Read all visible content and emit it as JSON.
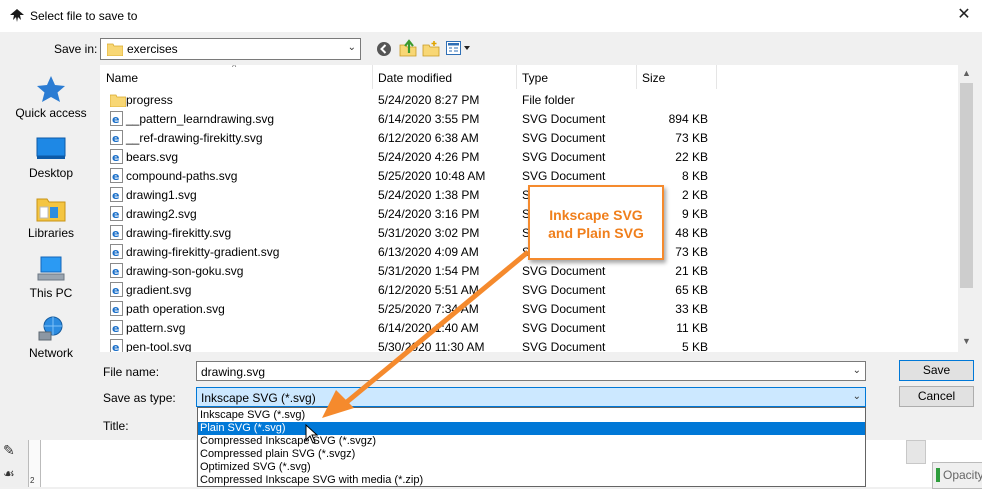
{
  "window": {
    "title": "Select file to save to"
  },
  "toolbar": {
    "save_in_label": "Save in:",
    "save_in_value": "exercises"
  },
  "places": [
    {
      "label": "Quick access",
      "icon": "star-icon"
    },
    {
      "label": "Desktop",
      "icon": "desktop-icon"
    },
    {
      "label": "Libraries",
      "icon": "libraries-icon"
    },
    {
      "label": "This PC",
      "icon": "computer-icon"
    },
    {
      "label": "Network",
      "icon": "network-icon"
    }
  ],
  "columns": {
    "name": "Name",
    "date": "Date modified",
    "type": "Type",
    "size": "Size"
  },
  "files": [
    {
      "name": "progress",
      "date": "5/24/2020 8:27 PM",
      "type": "File folder",
      "size": "",
      "kind": "folder"
    },
    {
      "name": "__pattern_learndrawing.svg",
      "date": "6/14/2020 3:55 PM",
      "type": "SVG Document",
      "size": "894 KB",
      "kind": "svg"
    },
    {
      "name": "__ref-drawing-firekitty.svg",
      "date": "6/12/2020 6:38 AM",
      "type": "SVG Document",
      "size": "73 KB",
      "kind": "svg"
    },
    {
      "name": "bears.svg",
      "date": "5/24/2020 4:26 PM",
      "type": "SVG Document",
      "size": "22 KB",
      "kind": "svg"
    },
    {
      "name": "compound-paths.svg",
      "date": "5/25/2020 10:48 AM",
      "type": "SVG Document",
      "size": "8 KB",
      "kind": "svg"
    },
    {
      "name": "drawing1.svg",
      "date": "5/24/2020 1:38 PM",
      "type": "S",
      "size": "2 KB",
      "kind": "svg"
    },
    {
      "name": "drawing2.svg",
      "date": "5/24/2020 3:16 PM",
      "type": "S",
      "size": "9 KB",
      "kind": "svg"
    },
    {
      "name": "drawing-firekitty.svg",
      "date": "5/31/2020 3:02 PM",
      "type": "S",
      "size": "48 KB",
      "kind": "svg"
    },
    {
      "name": "drawing-firekitty-gradient.svg",
      "date": "6/13/2020 4:09 AM",
      "type": "S",
      "size": "73 KB",
      "kind": "svg"
    },
    {
      "name": "drawing-son-goku.svg",
      "date": "5/31/2020 1:54 PM",
      "type": "SVG Document",
      "size": "21 KB",
      "kind": "svg"
    },
    {
      "name": "gradient.svg",
      "date": "6/12/2020 5:51 AM",
      "type": "SVG Document",
      "size": "65 KB",
      "kind": "svg"
    },
    {
      "name": "path operation.svg",
      "date": "5/25/2020 7:34 AM",
      "type": "SVG Document",
      "size": "33 KB",
      "kind": "svg"
    },
    {
      "name": "pattern.svg",
      "date": "6/14/2020 1:40 AM",
      "type": "SVG Document",
      "size": "11 KB",
      "kind": "svg"
    },
    {
      "name": "pen-tool.svg",
      "date": "5/30/2020 11:30 AM",
      "type": "SVG Document",
      "size": "5 KB",
      "kind": "svg"
    }
  ],
  "form": {
    "file_name_label": "File name:",
    "file_name_value": "drawing.svg",
    "save_as_type_label": "Save as type:",
    "save_as_type_value": "Inkscape SVG (*.svg)",
    "title_label": "Title:"
  },
  "buttons": {
    "save": "Save",
    "cancel": "Cancel"
  },
  "type_options": [
    "Inkscape SVG (*.svg)",
    "Plain SVG (*.svg)",
    "Compressed Inkscape SVG (*.svgz)",
    "Compressed plain SVG (*.svgz)",
    "Optimized SVG (*.svg)",
    "Compressed Inkscape SVG with media (*.zip)"
  ],
  "selected_option_index": 1,
  "callout": {
    "line1": "Inkscape SVG",
    "line2": "and Plain SVG"
  },
  "background": {
    "opacity_label": "Opacity",
    "ruler_mark": "2"
  },
  "colors": {
    "accent": "#0078d7",
    "callout": "#f58a2d",
    "selection_bg": "#cce8ff"
  }
}
